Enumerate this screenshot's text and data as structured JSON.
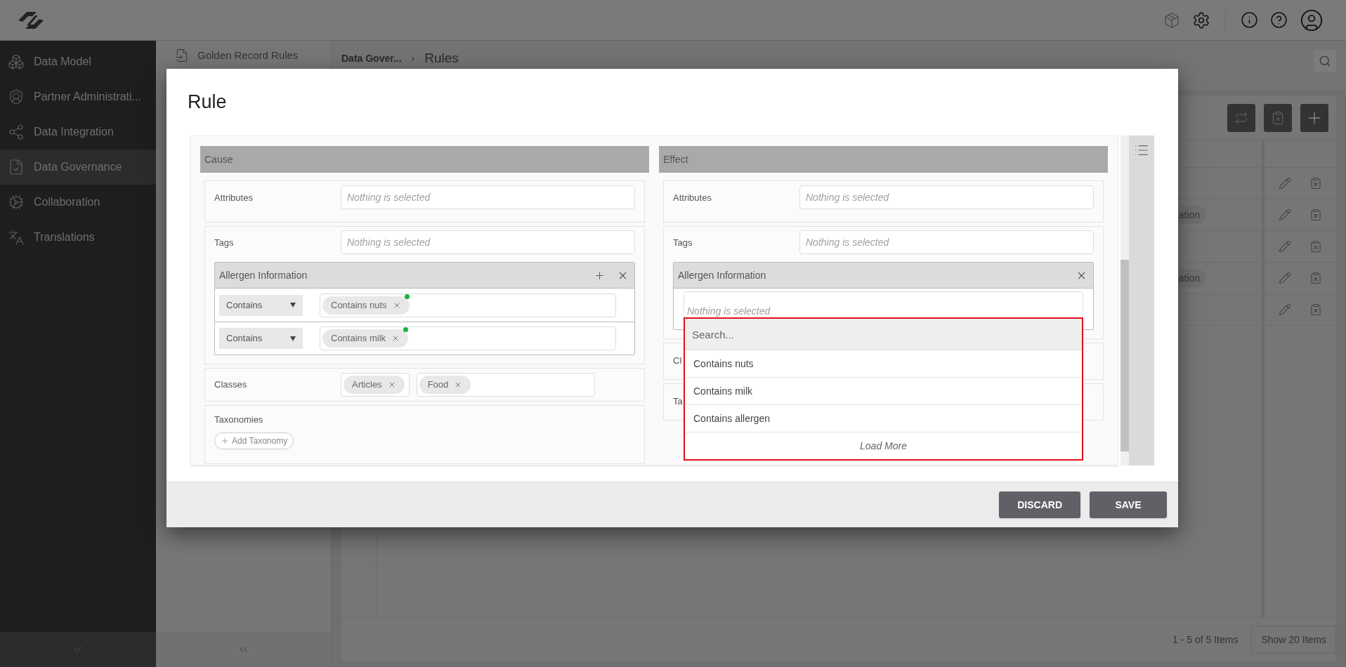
{
  "sidebar": {
    "items": [
      {
        "label": "Data Model",
        "selected": false
      },
      {
        "label": "Partner Administrati...",
        "selected": false
      },
      {
        "label": "Data Integration",
        "selected": false
      },
      {
        "label": "Data Governance",
        "selected": true
      },
      {
        "label": "Collaboration",
        "selected": false
      },
      {
        "label": "Translations",
        "selected": false
      }
    ]
  },
  "subpanel": {
    "items": [
      {
        "label": "Golden Record Rules"
      }
    ]
  },
  "breadcrumb": {
    "items": [
      "Data Gover...",
      "Rules"
    ],
    "separator": "›"
  },
  "table": {
    "rows": [
      {},
      {
        "tag": "ation"
      },
      {},
      {
        "tag": "ation"
      },
      {}
    ]
  },
  "pager": {
    "summary": "1 - 5 of 5 Items",
    "page_size": "Show 20 Items"
  },
  "modal": {
    "title": "Rule",
    "cause": {
      "header": "Cause",
      "sections": [
        {
          "kind": "field",
          "label": "Attributes",
          "placeholder": "Nothing is selected"
        },
        {
          "kind": "tags",
          "label": "Tags",
          "placeholder": "Nothing is selected",
          "group": {
            "title": "Allergen Information",
            "can_add": true,
            "rows": [
              {
                "operator": "Contains",
                "values": [
                  {
                    "label": "Contains nuts",
                    "color": "#17b33c"
                  }
                ]
              },
              {
                "operator": "Contains",
                "values": [
                  {
                    "label": "Contains milk",
                    "color": "#17b33c"
                  }
                ]
              }
            ]
          }
        },
        {
          "kind": "chips",
          "label": "Classes",
          "fields": [
            [
              "Articles"
            ],
            [
              "Food"
            ]
          ]
        },
        {
          "kind": "taxonomy",
          "label": "Taxonomies",
          "button": "Add Taxonomy"
        }
      ]
    },
    "effect": {
      "header": "Effect",
      "sections": [
        {
          "kind": "field",
          "label": "Attributes",
          "placeholder": "Nothing is selected"
        },
        {
          "kind": "tags",
          "label": "Tags",
          "placeholder": "Nothing is selected",
          "group": {
            "title": "Allergen Information",
            "can_add": false,
            "placeholder": "Nothing is selected",
            "dropdown": {
              "placeholder": "Search...",
              "options": [
                "Contains nuts",
                "Contains milk",
                "Contains allergen"
              ],
              "load_more": "Load More"
            }
          }
        },
        {
          "kind": "covered",
          "label": "Cl"
        },
        {
          "kind": "covered",
          "label": "Ta"
        }
      ]
    },
    "buttons": [
      {
        "label": "DISCARD"
      },
      {
        "label": "SAVE"
      }
    ]
  }
}
